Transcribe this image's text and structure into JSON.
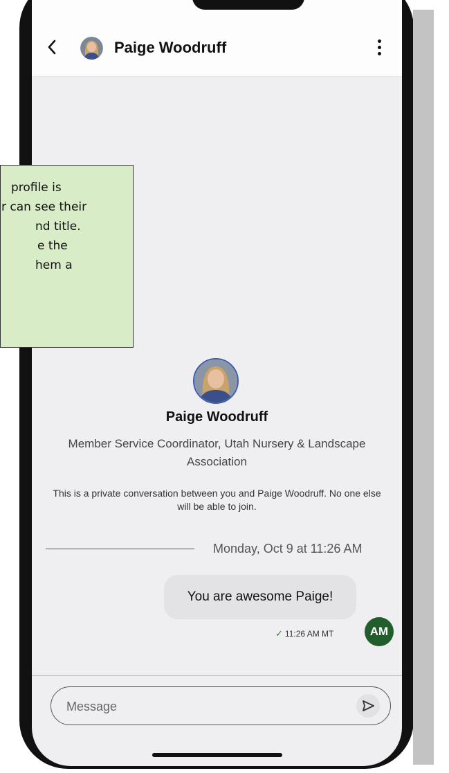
{
  "header": {
    "contact_name": "Paige Woodruff",
    "back_icon": "chevron-left-icon",
    "menu_icon": "more-vertical-icon"
  },
  "profile": {
    "name": "Paige Woodruff",
    "title": "Member Service Coordinator, Utah Nursery & Landscape Association",
    "privacy_note": "This is a private conversation between you and Paige Woodruff. No one else will be able to join."
  },
  "thread": {
    "date_divider": "Monday, Oct 9 at 11:26 AM",
    "messages": [
      {
        "text": "You are awesome Paige!",
        "status_icon": "checkmark-icon",
        "time": "11:26 AM MT",
        "sender_initials": "AM",
        "sender_color": "#225e2c"
      }
    ]
  },
  "composer": {
    "placeholder": "Message",
    "send_icon": "send-icon"
  },
  "annotation": {
    "lines": [
      "profile is",
      "r can see their",
      "nd title.",
      "e the",
      "hem a"
    ],
    "background": "#d8ecc8"
  }
}
